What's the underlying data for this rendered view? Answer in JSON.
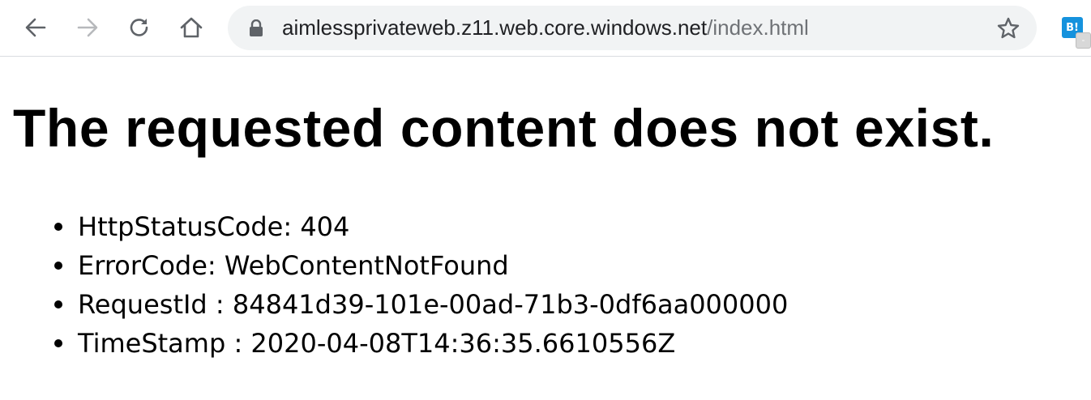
{
  "browser": {
    "url_host": "aimlessprivateweb.z11.web.core.windows.net",
    "url_path": "/index.html",
    "extension_label": "B!",
    "extension_badge": "-"
  },
  "page": {
    "heading": "The requested content does not exist.",
    "details": [
      "HttpStatusCode: 404",
      "ErrorCode: WebContentNotFound",
      "RequestId : 84841d39-101e-00ad-71b3-0df6aa000000",
      "TimeStamp : 2020-04-08T14:36:35.6610556Z"
    ]
  },
  "colors": {
    "omnibox_bg": "#f1f3f4",
    "url_host": "#202124",
    "url_path": "#6f7276",
    "extension_bg": "#1592dd"
  },
  "icons": [
    "back-arrow-icon",
    "forward-arrow-icon",
    "reload-icon",
    "home-icon",
    "lock-icon",
    "star-icon"
  ]
}
